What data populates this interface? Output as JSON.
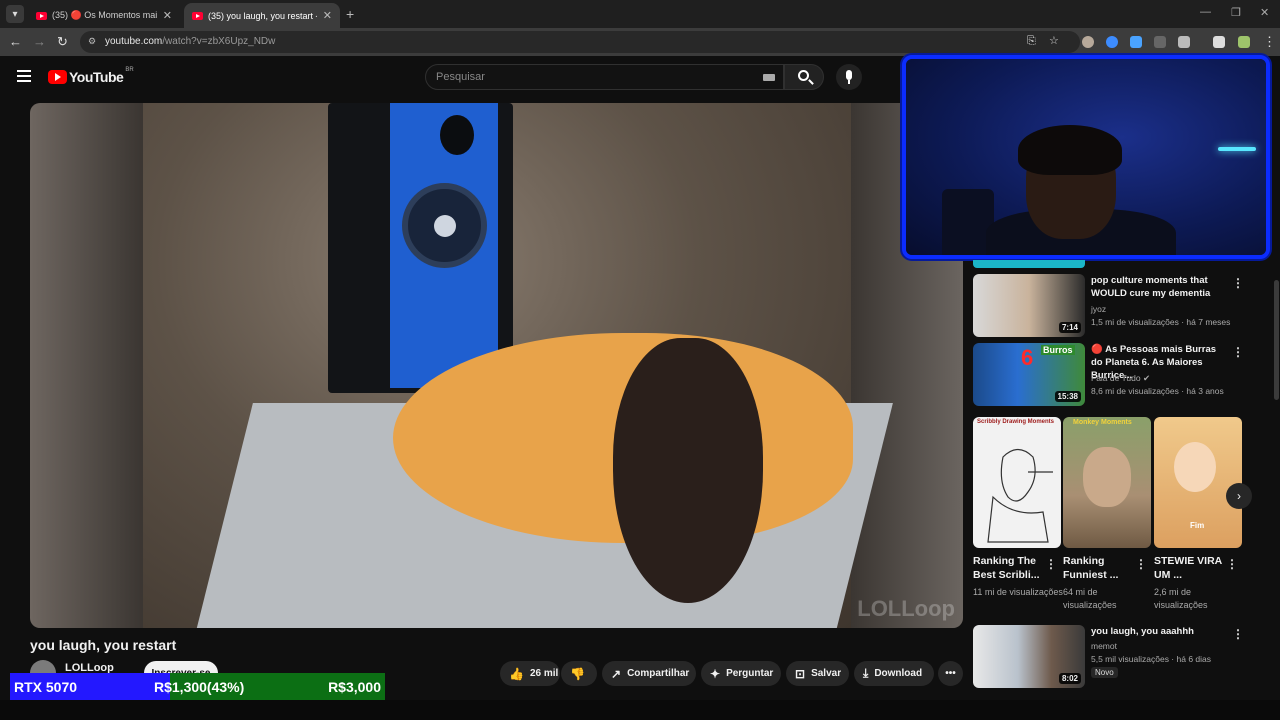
{
  "browser": {
    "tabs": [
      {
        "label": "(35) 🔴 Os Momentos mais Ve",
        "active": false
      },
      {
        "label": "(35) you laugh, you restart - Yo",
        "active": true
      }
    ],
    "new_tab_icon": "plus-icon",
    "url_host": "youtube.com",
    "url_path": "/watch?v=zbX6Upz_NDw"
  },
  "youtube": {
    "logo_text": "YouTube",
    "region": "BR",
    "search_placeholder": "Pesquisar"
  },
  "video": {
    "title": "you laugh, you restart",
    "watermark": "LOLLoop",
    "channel": "LOLLoop",
    "subscribe_label": "Inscrever-se",
    "likes": "26 mil",
    "share_label": "Compartilhar",
    "ask_label": "Perguntar",
    "save_label": "Salvar",
    "download_label": "Download",
    "more_label": "•••"
  },
  "overlay": {
    "product": "RTX 5070",
    "current": "R$1,300(43%)",
    "goal": "R$3,000",
    "progress_fraction": 0.43,
    "colors": {
      "left": "#2318ff",
      "right": "#0c6f14"
    }
  },
  "recommendations": [
    {
      "title": "pop culture moments that WOULD cure my dementia",
      "channel": "jyoz",
      "meta": "1,5 mi de visualizações · há 7 meses",
      "duration": "7:14"
    },
    {
      "title": "🔴 As Pessoas mais Burras do Planeta 6. As Maiores Burrice...",
      "channel": "Fala de Tudo",
      "meta": "8,6 mi de visualizações · há 3 anos",
      "duration": "15:38"
    },
    {
      "title": "you laugh, you aaahhh",
      "channel": "memot",
      "meta": "5,5 mil visualizações · há 6 dias",
      "duration": "8:02",
      "badge": "Novo"
    }
  ],
  "shorts": [
    {
      "title": "Ranking The Best Scribli...",
      "views": "11 mi de visualizações",
      "thumb_text": "Scribbly Drawing Moments"
    },
    {
      "title": "Ranking Funniest ...",
      "views": "64 mi de visualizações",
      "thumb_text": "Monkey Moments"
    },
    {
      "title": "STEWIE VIRA UM ...",
      "views": "2,6 mi de visualizações",
      "thumb_text": "Fim"
    }
  ],
  "thumb_texts": {
    "rec2_badge": "6",
    "rec2_word": "Burros"
  }
}
